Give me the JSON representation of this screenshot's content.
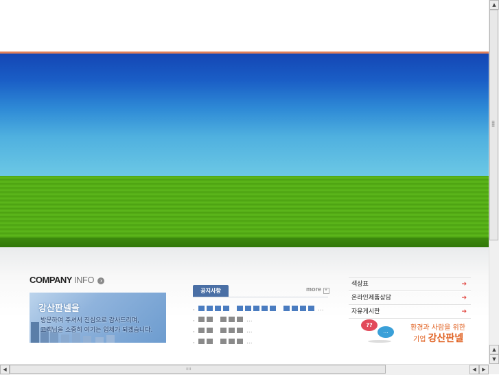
{
  "company_info": {
    "heading_main": "COMPANY",
    "heading_sub": "INFO",
    "heading_icon": "info-circle-icon",
    "banner_title": "강산판넬을",
    "banner_line1": "방문하여 주셔서 진심으로 감사드리며,",
    "banner_line2": "고객님을 소중히 여기는 업체가 되겠습니다."
  },
  "notice": {
    "tab_label": "공지사항",
    "more_label": "more",
    "items": [
      {
        "bullet": "·",
        "blocks": [
          4,
          5,
          4
        ],
        "ellipsis": "...",
        "color": "#4a7cc0"
      },
      {
        "bullet": "·",
        "blocks": [
          2,
          3
        ],
        "ellipsis": "...",
        "color": "#8a8a8a"
      },
      {
        "bullet": "·",
        "blocks": [
          2,
          3
        ],
        "ellipsis": "...",
        "color": "#8a8a8a"
      },
      {
        "bullet": "·",
        "blocks": [
          2,
          3
        ],
        "ellipsis": "...",
        "color": "#8a8a8a"
      }
    ]
  },
  "side_links": [
    {
      "label": "색상표",
      "arrow": "➔"
    },
    {
      "label": "온라인제품상담",
      "arrow": "➔"
    },
    {
      "label": "자유게시판",
      "arrow": "➔"
    }
  ],
  "slogan": {
    "bubble_left": "??",
    "bubble_right": "...",
    "line1": "환경과 사람을 위한",
    "line2_prefix": "기업",
    "line2_brand": "강산판넬"
  },
  "scrollbar": {
    "up": "▲",
    "down": "▼",
    "left": "◀",
    "right": "▶"
  },
  "colors": {
    "accent_orange": "#e0805a",
    "sky_blue": "#1a5ec6",
    "grass_green": "#5db81c",
    "notice_tab": "#4a6fa5",
    "slogan_orange": "#e06020"
  }
}
